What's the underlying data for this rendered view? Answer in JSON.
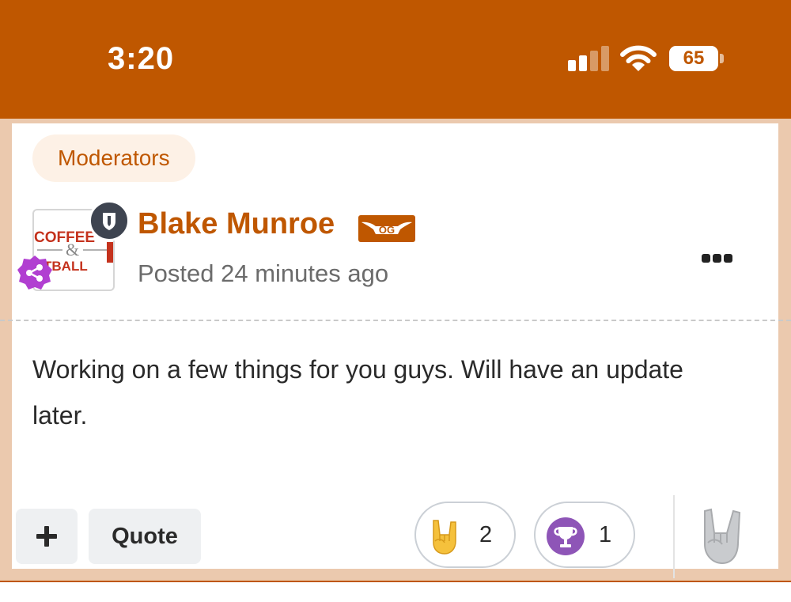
{
  "status_bar": {
    "time": "3:20",
    "battery_percent": "65",
    "signal_bars_active": 2,
    "signal_bars_total": 4,
    "icons": [
      "signal-icon",
      "wifi-icon",
      "battery-icon"
    ]
  },
  "post": {
    "group_label": "Moderators",
    "author": {
      "name": "Blake Munroe",
      "avatar_text": [
        "COFFEE",
        "&",
        "TBALL"
      ],
      "badge_text": "OG",
      "is_moderator": true
    },
    "meta": "Posted 24 minutes ago",
    "body": "Working on a few things for you guys. Will have an update later."
  },
  "actions": {
    "quote_label": "Quote",
    "reactions": [
      {
        "icon": "rock-on-hand-icon",
        "count": "2"
      },
      {
        "icon": "trophy-icon",
        "count": "1"
      }
    ]
  },
  "colors": {
    "accent": "#bf5700",
    "card_border": "#ebc9ae",
    "pill_bg": "#fdf1e6",
    "mod_badge": "#3e4450",
    "share_badge": "#b13fd1",
    "trophy_badge": "#8e55b7"
  }
}
